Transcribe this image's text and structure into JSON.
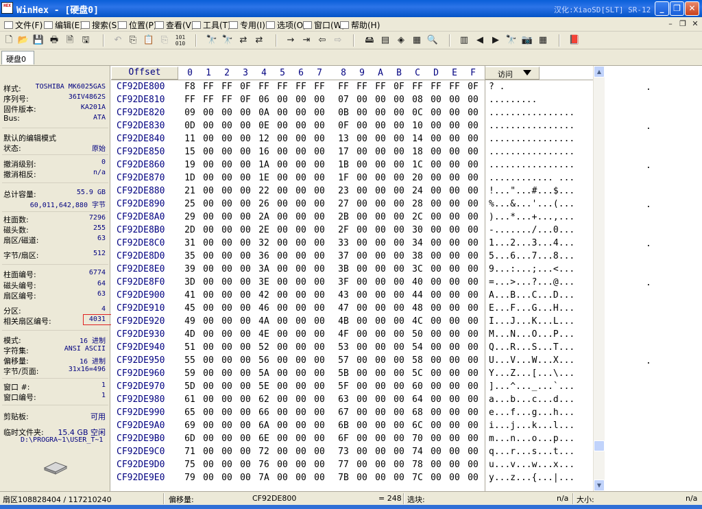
{
  "window": {
    "title": "WinHex - [硬盘0]",
    "credit": "汉化:XiaoSD[SLT] SR-12",
    "app_icon_text": "HEX"
  },
  "menu": [
    "文件(F)",
    "编辑(E)",
    "搜索(S)",
    "位置(P)",
    "查看(V)",
    "工具(T)",
    "专用(I)",
    "选项(O)",
    "窗口(W)",
    "帮助(H)"
  ],
  "tab": "硬盘0",
  "info": {
    "model_label": "样式:",
    "model": "TOSHIBA MK6025GAS",
    "serial_label": "序列号:",
    "serial": "36IV4862S",
    "firmware_label": "固件版本:",
    "firmware": "KA201A",
    "bus_label": "Bus:",
    "bus": "ATA",
    "edit_mode_label": "默认的编辑模式",
    "state_label": "状态:",
    "state": "原始",
    "undo_level_label": "撤消级别:",
    "undo_level": "0",
    "undo_inverse_label": "撤消相反:",
    "undo_inverse": "n/a",
    "total_label": "总计容量:",
    "total_gb": "55.9 GB",
    "total_bytes": "60,011,642,880 字节",
    "cylinders_label": "柱面数:",
    "cylinders": "7296",
    "heads_label": "磁头数:",
    "heads": "255",
    "sectors_track_label": "扇区/磁道:",
    "sectors_track": "63",
    "bytes_sector_label": "字节/扇区:",
    "bytes_sector": "512",
    "cyl_no_label": "柱面编号:",
    "cyl_no": "6774",
    "head_no_label": "磁头编号:",
    "head_no": "64",
    "sector_no_label": "扇区编号:",
    "sector_no": "63",
    "partition_label": "分区:",
    "partition": "4",
    "rel_sector_label": "相关扇区编号:",
    "rel_sector": "4031",
    "mode_label": "模式:",
    "mode": "16 进制",
    "charset_label": "字符集:",
    "charset": "ANSI ASCII",
    "offset_label": "偏移量:",
    "offset": "16 进制",
    "bytes_page_label": "字节/页面:",
    "bytes_page": "31x16=496",
    "window_no_label": "窗口 #:",
    "window_no": "1",
    "window_count_label": "窗口编号:",
    "window_count": "1",
    "clipboard_label": "剪贴板:",
    "clipboard": "可用",
    "temp_label": "临时文件夹:",
    "temp": "15.4 GB 空闲",
    "temp_path": "D:\\PROGRA~1\\USER_T~1"
  },
  "hex": {
    "offset_header": "Offset",
    "columns": [
      "0",
      "1",
      "2",
      "3",
      "4",
      "5",
      "6",
      "7",
      "8",
      "9",
      "A",
      "B",
      "C",
      "D",
      "E",
      "F"
    ],
    "access_label": "访问",
    "rows": [
      {
        "off": "CF92DE800",
        "bytes": [
          "F8",
          "FF",
          "FF",
          "0F",
          "FF",
          "FF",
          "FF",
          "FF",
          "FF",
          "FF",
          "FF",
          "0F",
          "FF",
          "FF",
          "FF",
          "0F"
        ],
        "ascii": "?   ."
      },
      {
        "off": "CF92DE810",
        "bytes": [
          "FF",
          "FF",
          "FF",
          "0F",
          "06",
          "00",
          "00",
          "00",
          "07",
          "00",
          "00",
          "00",
          "08",
          "00",
          "00",
          "00"
        ],
        "ascii": "       ........."
      },
      {
        "off": "CF92DE820",
        "bytes": [
          "09",
          "00",
          "00",
          "00",
          "0A",
          "00",
          "00",
          "00",
          "0B",
          "00",
          "00",
          "00",
          "0C",
          "00",
          "00",
          "00"
        ],
        "ascii": "................"
      },
      {
        "off": "CF92DE830",
        "bytes": [
          "0D",
          "00",
          "00",
          "00",
          "0E",
          "00",
          "00",
          "00",
          "0F",
          "00",
          "00",
          "00",
          "10",
          "00",
          "00",
          "00"
        ],
        "ascii": "................"
      },
      {
        "off": "CF92DE840",
        "bytes": [
          "11",
          "00",
          "00",
          "00",
          "12",
          "00",
          "00",
          "00",
          "13",
          "00",
          "00",
          "00",
          "14",
          "00",
          "00",
          "00"
        ],
        "ascii": "................"
      },
      {
        "off": "CF92DE850",
        "bytes": [
          "15",
          "00",
          "00",
          "00",
          "16",
          "00",
          "00",
          "00",
          "17",
          "00",
          "00",
          "00",
          "18",
          "00",
          "00",
          "00"
        ],
        "ascii": "................"
      },
      {
        "off": "CF92DE860",
        "bytes": [
          "19",
          "00",
          "00",
          "00",
          "1A",
          "00",
          "00",
          "00",
          "1B",
          "00",
          "00",
          "00",
          "1C",
          "00",
          "00",
          "00"
        ],
        "ascii": "................"
      },
      {
        "off": "CF92DE870",
        "bytes": [
          "1D",
          "00",
          "00",
          "00",
          "1E",
          "00",
          "00",
          "00",
          "1F",
          "00",
          "00",
          "00",
          "20",
          "00",
          "00",
          "00"
        ],
        "ascii": "............ ..."
      },
      {
        "off": "CF92DE880",
        "bytes": [
          "21",
          "00",
          "00",
          "00",
          "22",
          "00",
          "00",
          "00",
          "23",
          "00",
          "00",
          "00",
          "24",
          "00",
          "00",
          "00"
        ],
        "ascii": "!...\"...#...$..."
      },
      {
        "off": "CF92DE890",
        "bytes": [
          "25",
          "00",
          "00",
          "00",
          "26",
          "00",
          "00",
          "00",
          "27",
          "00",
          "00",
          "00",
          "28",
          "00",
          "00",
          "00"
        ],
        "ascii": "%...&...'...(..."
      },
      {
        "off": "CF92DE8A0",
        "bytes": [
          "29",
          "00",
          "00",
          "00",
          "2A",
          "00",
          "00",
          "00",
          "2B",
          "00",
          "00",
          "00",
          "2C",
          "00",
          "00",
          "00"
        ],
        "ascii": ")...*...+...,..."
      },
      {
        "off": "CF92DE8B0",
        "bytes": [
          "2D",
          "00",
          "00",
          "00",
          "2E",
          "00",
          "00",
          "00",
          "2F",
          "00",
          "00",
          "00",
          "30",
          "00",
          "00",
          "00"
        ],
        "ascii": "-......./...0..."
      },
      {
        "off": "CF92DE8C0",
        "bytes": [
          "31",
          "00",
          "00",
          "00",
          "32",
          "00",
          "00",
          "00",
          "33",
          "00",
          "00",
          "00",
          "34",
          "00",
          "00",
          "00"
        ],
        "ascii": "1...2...3...4..."
      },
      {
        "off": "CF92DE8D0",
        "bytes": [
          "35",
          "00",
          "00",
          "00",
          "36",
          "00",
          "00",
          "00",
          "37",
          "00",
          "00",
          "00",
          "38",
          "00",
          "00",
          "00"
        ],
        "ascii": "5...6...7...8..."
      },
      {
        "off": "CF92DE8E0",
        "bytes": [
          "39",
          "00",
          "00",
          "00",
          "3A",
          "00",
          "00",
          "00",
          "3B",
          "00",
          "00",
          "00",
          "3C",
          "00",
          "00",
          "00"
        ],
        "ascii": "9...:...;...<..."
      },
      {
        "off": "CF92DE8F0",
        "bytes": [
          "3D",
          "00",
          "00",
          "00",
          "3E",
          "00",
          "00",
          "00",
          "3F",
          "00",
          "00",
          "00",
          "40",
          "00",
          "00",
          "00"
        ],
        "ascii": "=...>...?...@..."
      },
      {
        "off": "CF92DE900",
        "bytes": [
          "41",
          "00",
          "00",
          "00",
          "42",
          "00",
          "00",
          "00",
          "43",
          "00",
          "00",
          "00",
          "44",
          "00",
          "00",
          "00"
        ],
        "ascii": "A...B...C...D..."
      },
      {
        "off": "CF92DE910",
        "bytes": [
          "45",
          "00",
          "00",
          "00",
          "46",
          "00",
          "00",
          "00",
          "47",
          "00",
          "00",
          "00",
          "48",
          "00",
          "00",
          "00"
        ],
        "ascii": "E...F...G...H..."
      },
      {
        "off": "CF92DE920",
        "bytes": [
          "49",
          "00",
          "00",
          "00",
          "4A",
          "00",
          "00",
          "00",
          "4B",
          "00",
          "00",
          "00",
          "4C",
          "00",
          "00",
          "00"
        ],
        "ascii": "I...J...K...L..."
      },
      {
        "off": "CF92DE930",
        "bytes": [
          "4D",
          "00",
          "00",
          "00",
          "4E",
          "00",
          "00",
          "00",
          "4F",
          "00",
          "00",
          "00",
          "50",
          "00",
          "00",
          "00"
        ],
        "ascii": "M...N...O...P..."
      },
      {
        "off": "CF92DE940",
        "bytes": [
          "51",
          "00",
          "00",
          "00",
          "52",
          "00",
          "00",
          "00",
          "53",
          "00",
          "00",
          "00",
          "54",
          "00",
          "00",
          "00"
        ],
        "ascii": "Q...R...S...T..."
      },
      {
        "off": "CF92DE950",
        "bytes": [
          "55",
          "00",
          "00",
          "00",
          "56",
          "00",
          "00",
          "00",
          "57",
          "00",
          "00",
          "00",
          "58",
          "00",
          "00",
          "00"
        ],
        "ascii": "U...V...W...X..."
      },
      {
        "off": "CF92DE960",
        "bytes": [
          "59",
          "00",
          "00",
          "00",
          "5A",
          "00",
          "00",
          "00",
          "5B",
          "00",
          "00",
          "00",
          "5C",
          "00",
          "00",
          "00"
        ],
        "ascii": "Y...Z...[...\\..."
      },
      {
        "off": "CF92DE970",
        "bytes": [
          "5D",
          "00",
          "00",
          "00",
          "5E",
          "00",
          "00",
          "00",
          "5F",
          "00",
          "00",
          "00",
          "60",
          "00",
          "00",
          "00"
        ],
        "ascii": "]...^..._...`..."
      },
      {
        "off": "CF92DE980",
        "bytes": [
          "61",
          "00",
          "00",
          "00",
          "62",
          "00",
          "00",
          "00",
          "63",
          "00",
          "00",
          "00",
          "64",
          "00",
          "00",
          "00"
        ],
        "ascii": "a...b...c...d..."
      },
      {
        "off": "CF92DE990",
        "bytes": [
          "65",
          "00",
          "00",
          "00",
          "66",
          "00",
          "00",
          "00",
          "67",
          "00",
          "00",
          "00",
          "68",
          "00",
          "00",
          "00"
        ],
        "ascii": "e...f...g...h..."
      },
      {
        "off": "CF92DE9A0",
        "bytes": [
          "69",
          "00",
          "00",
          "00",
          "6A",
          "00",
          "00",
          "00",
          "6B",
          "00",
          "00",
          "00",
          "6C",
          "00",
          "00",
          "00"
        ],
        "ascii": "i...j...k...l..."
      },
      {
        "off": "CF92DE9B0",
        "bytes": [
          "6D",
          "00",
          "00",
          "00",
          "6E",
          "00",
          "00",
          "00",
          "6F",
          "00",
          "00",
          "00",
          "70",
          "00",
          "00",
          "00"
        ],
        "ascii": "m...n...o...p..."
      },
      {
        "off": "CF92DE9C0",
        "bytes": [
          "71",
          "00",
          "00",
          "00",
          "72",
          "00",
          "00",
          "00",
          "73",
          "00",
          "00",
          "00",
          "74",
          "00",
          "00",
          "00"
        ],
        "ascii": "q...r...s...t..."
      },
      {
        "off": "CF92DE9D0",
        "bytes": [
          "75",
          "00",
          "00",
          "00",
          "76",
          "00",
          "00",
          "00",
          "77",
          "00",
          "00",
          "00",
          "78",
          "00",
          "00",
          "00"
        ],
        "ascii": "u...v...w...x..."
      },
      {
        "off": "CF92DE9E0",
        "bytes": [
          "79",
          "00",
          "00",
          "00",
          "7A",
          "00",
          "00",
          "00",
          "7B",
          "00",
          "00",
          "00",
          "7C",
          "00",
          "00",
          "00"
        ],
        "ascii": "y...z...{...|..."
      }
    ]
  },
  "status": {
    "sector": "扇区108828404 / 117210240",
    "offset_label": "偏移量:",
    "offset_value": "CF92DE800",
    "eq": "= 248",
    "block_label": "选块:",
    "block_value": "n/a",
    "size_label": "大小:",
    "size_value": "n/a"
  }
}
